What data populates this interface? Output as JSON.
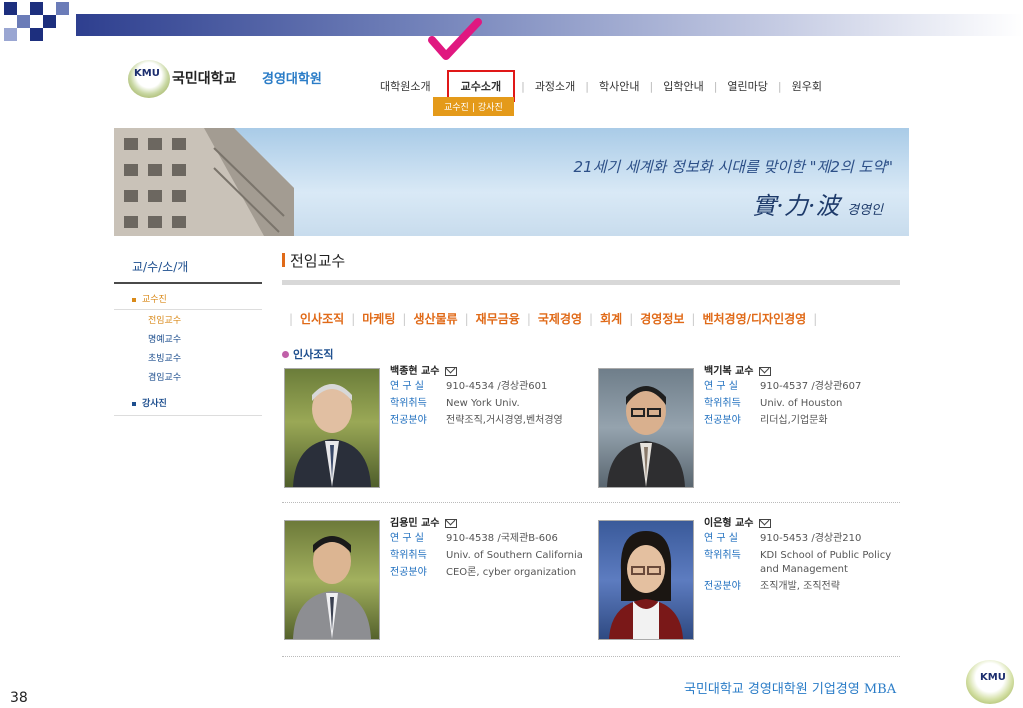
{
  "header": {
    "logo_text": "KMU",
    "university": "국민대학교",
    "school": "경영대학원",
    "nav": [
      "대학원소개",
      "교수소개",
      "과정소개",
      "학사안내",
      "입학안내",
      "열린마당",
      "원우회"
    ],
    "subnav": [
      "교수진",
      "강사진"
    ]
  },
  "banner": {
    "line1": "21세기 세계화 정보화 시대를 맞이한 \"제2의 도약\"",
    "line2": "實·力·波",
    "line2_suffix": "경영인"
  },
  "sidebar": {
    "title": "교/수/소/개",
    "main_item": "교수진",
    "sub_items": [
      "전임교수",
      "명예교수",
      "초빙교수",
      "겸임교수"
    ],
    "second_item": "강사진"
  },
  "content": {
    "title": "전임교수",
    "categories": [
      "인사조직",
      "마케팅",
      "생산물류",
      "재무금융",
      "국제경영",
      "회계",
      "경영정보",
      "벤처경영/디자인경영"
    ],
    "section": "인사조직",
    "labels": {
      "office": "연 구 실",
      "degree": "학위취득",
      "field": "전공분야"
    },
    "professors": [
      {
        "name": "백종현 교수",
        "office": "910-4534 /경상관601",
        "degree": "New York Univ.",
        "field": "전략조직,거시경영,벤처경영"
      },
      {
        "name": "백기복 교수",
        "office": "910-4537 /경상관607",
        "degree": "Univ. of Houston",
        "field": "리더십,기업문화"
      },
      {
        "name": "김용민 교수",
        "office": "910-4538 /국제관B-606",
        "degree": "Univ. of Southern California",
        "field": "CEO론, cyber organization"
      },
      {
        "name": "이은형 교수",
        "office": "910-5453 /경상관210",
        "degree": "KDI School of Public Policy and Management",
        "field": "조직개발, 조직전략"
      }
    ]
  },
  "footer": {
    "page_number": "38",
    "text": "국민대학교 경영대학원 기업경영 MBA",
    "logo_text": "KMU"
  },
  "colors": {
    "accent_orange": "#e06a18",
    "link_blue": "#1f6fbf",
    "highlight_red": "#e01818",
    "subnav_bg": "#e49a1a"
  }
}
